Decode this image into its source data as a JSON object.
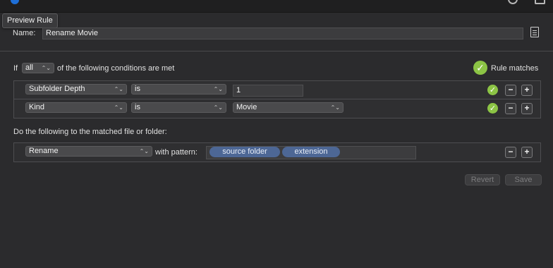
{
  "tooltip": "Preview Rule",
  "name": {
    "label": "Name:",
    "value": "Rename Movie"
  },
  "conditions_header": {
    "prefix": "If",
    "match_mode": "all",
    "suffix": "of the following conditions are met",
    "status": "Rule matches"
  },
  "conditions": [
    {
      "attribute": "Subfolder Depth",
      "operator": "is",
      "value": "1",
      "value_kind": "text"
    },
    {
      "attribute": "Kind",
      "operator": "is",
      "value": "Movie",
      "value_kind": "popup"
    }
  ],
  "actions_header": "Do the following to the matched file or folder:",
  "action": {
    "type": "Rename",
    "with_label": "with pattern:",
    "tokens": [
      "source folder",
      "extension"
    ]
  },
  "buttons": {
    "revert": "Revert",
    "save": "Save",
    "minus": "−",
    "plus": "+",
    "check": "✓"
  },
  "colors": {
    "check_green": "#8cc445",
    "token_blue": "#4d6795",
    "background": "#2b2b2d"
  }
}
